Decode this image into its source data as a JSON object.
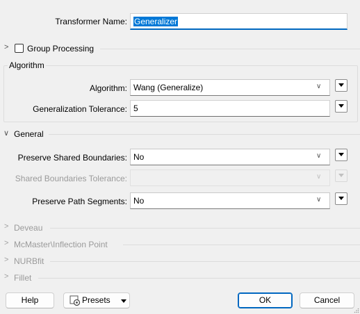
{
  "transformer": {
    "name_label": "Transformer Name:",
    "name_value": "Generalizer"
  },
  "group_processing": {
    "label": "Group Processing",
    "checked": false
  },
  "algorithm_section": {
    "title": "Algorithm",
    "algorithm_label": "Algorithm:",
    "algorithm_value": "Wang (Generalize)",
    "tolerance_label": "Generalization Tolerance:",
    "tolerance_value": "5"
  },
  "general_section": {
    "title": "General",
    "preserve_shared_label": "Preserve Shared Boundaries:",
    "preserve_shared_value": "No",
    "shared_tolerance_label": "Shared Boundaries Tolerance:",
    "shared_tolerance_value": "",
    "preserve_path_label": "Preserve Path Segments:",
    "preserve_path_value": "No"
  },
  "collapsed_sections": [
    {
      "title": "Deveau"
    },
    {
      "title": "McMaster\\Inflection Point"
    },
    {
      "title": "NURBfit"
    },
    {
      "title": "Fillet"
    }
  ],
  "buttons": {
    "help": "Help",
    "presets": "Presets",
    "ok": "OK",
    "cancel": "Cancel"
  },
  "icons": {
    "expand": "chevron-right-icon",
    "collapse": "chevron-down-icon",
    "presets": "gear-icon",
    "dropdown": "triangle-down-icon",
    "resize": "resize-grip-icon"
  },
  "colors": {
    "accent": "#0078d7",
    "window": "#f0f0f0"
  }
}
